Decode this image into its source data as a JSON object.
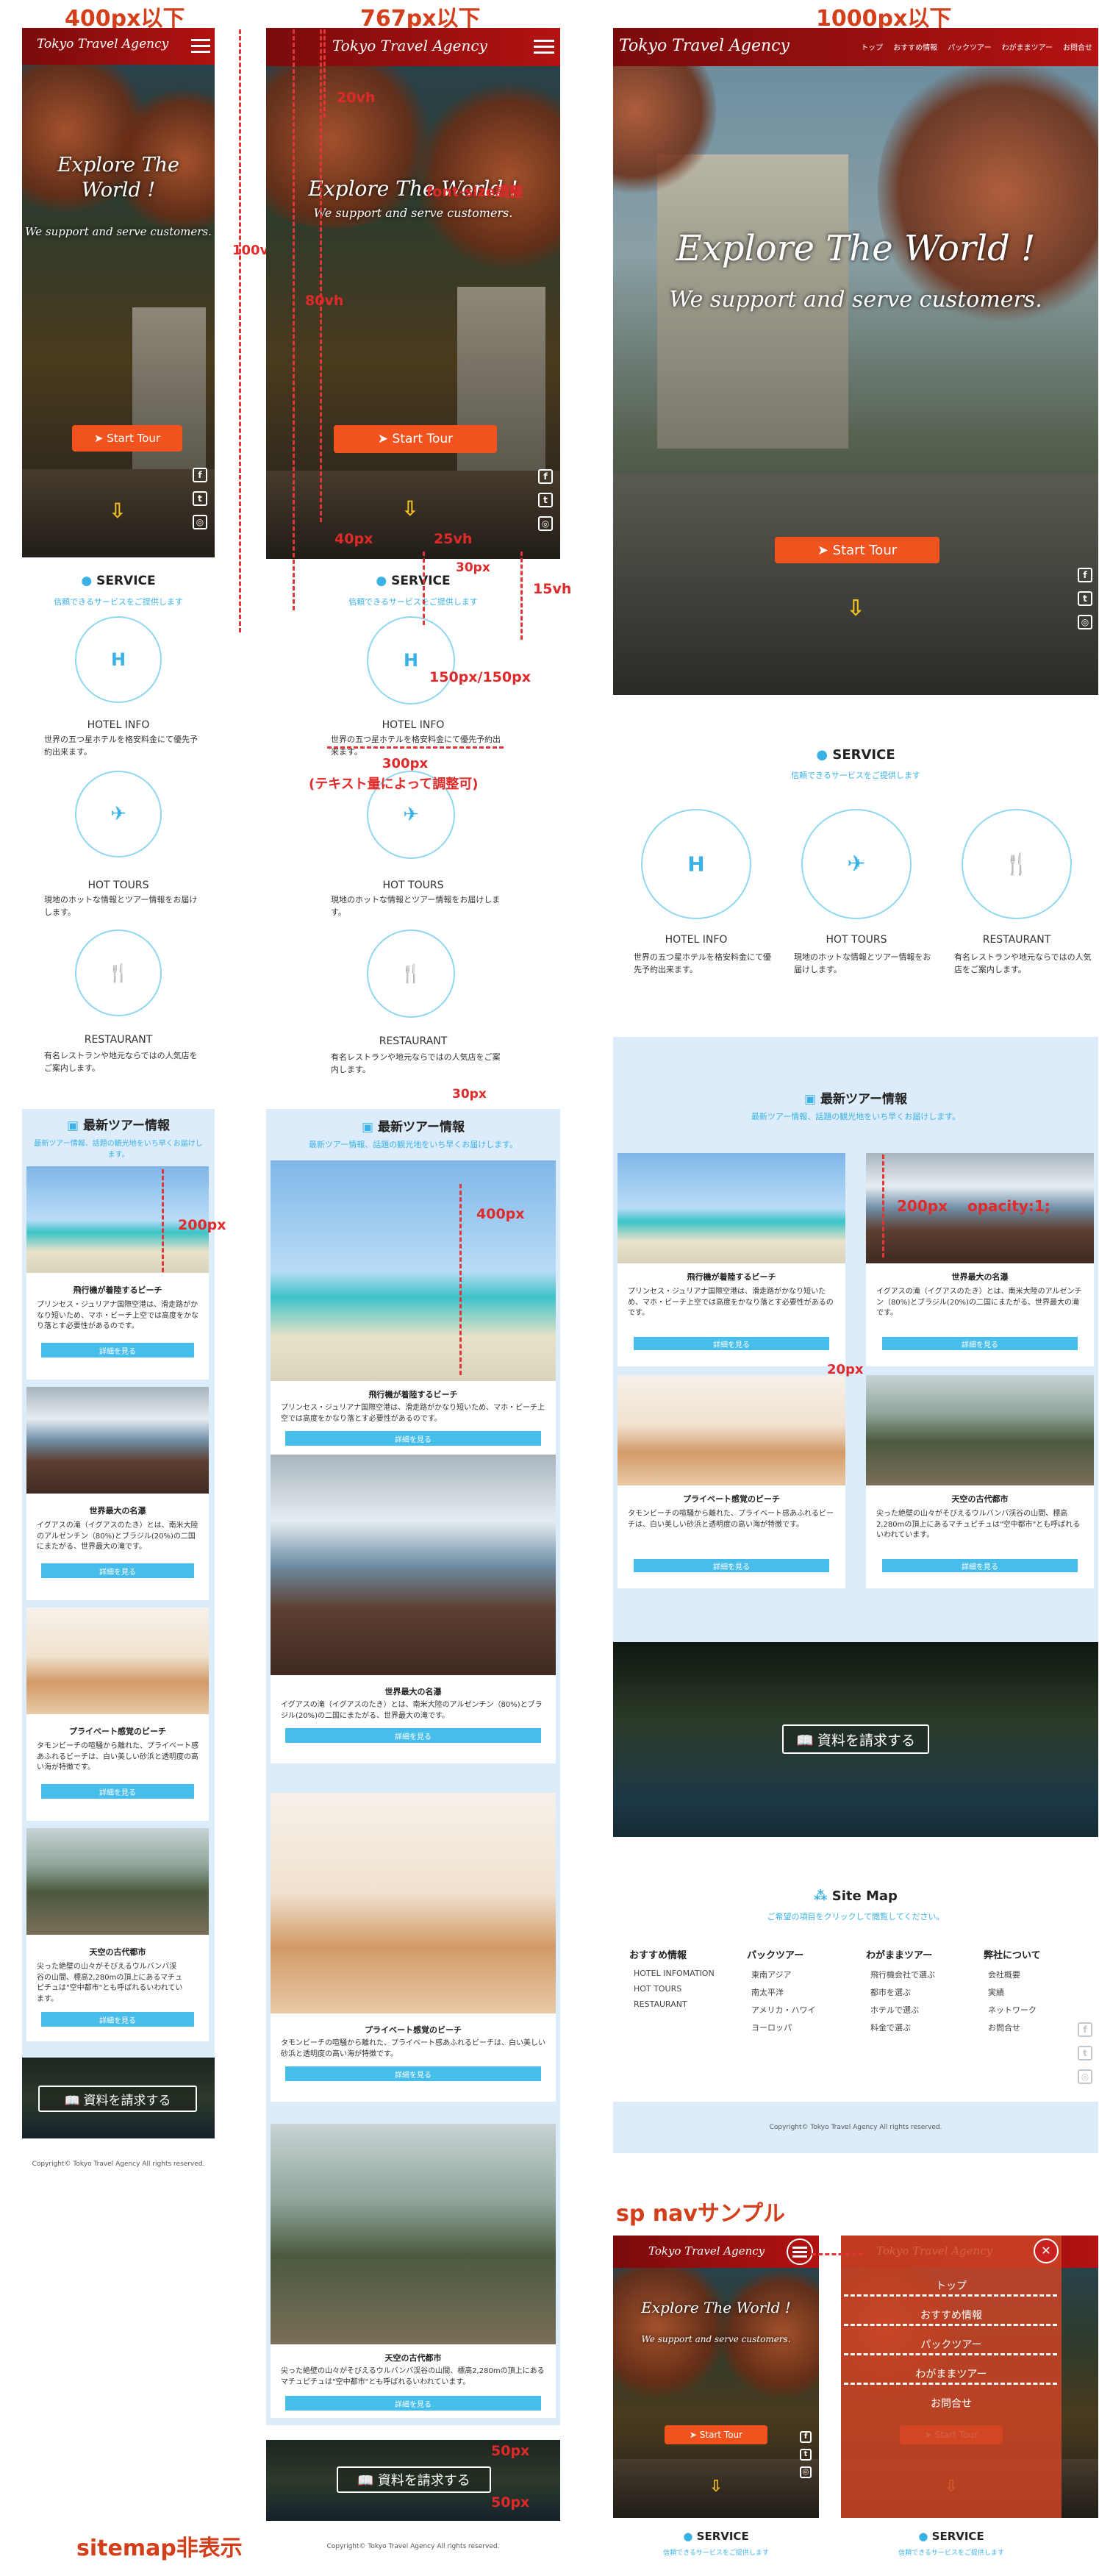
{
  "labels": {
    "h400": "400px以下",
    "h767": "767px以下",
    "h1000": "1000px以下",
    "sp_nav": "sp navサンプル",
    "sitemap_hidden": "sitemap非表示"
  },
  "annotations": {
    "vh100": "100vh",
    "vh80": "80vh",
    "vh20": "20vh",
    "fontsize": "font-size調整",
    "px40": "40px",
    "vh25": "25vh",
    "px30a": "30px",
    "vh15": "15vh",
    "circle_size": "150px/150px",
    "text_w": "300px",
    "text_w_note": "(テキスト量によって調整可)",
    "px30b": "30px",
    "px400": "400px",
    "px200a": "200px",
    "px200b": "200px",
    "opacity": "opacity:1;",
    "px20": "20px",
    "px50a": "50px",
    "px50b": "50px"
  },
  "brand": "Tokyo Travel Agency",
  "nav": [
    "トップ",
    "おすすめ情報",
    "パックツアー",
    "わがままツアー",
    "お問合せ"
  ],
  "hero": {
    "title": "Explore The World !",
    "subtitle": "We support and serve customers.",
    "button": "Start Tour",
    "scroll": "⇩"
  },
  "service": {
    "title": "SERVICE",
    "subtitle": "信頼できるサービスをご提供します",
    "items": [
      {
        "icon": "hotel-icon",
        "glyph": "H",
        "name": "HOTEL INFO",
        "desc": "世界の五つ星ホテルを格安料金にて優先予約出来ます。"
      },
      {
        "icon": "airplane-icon",
        "glyph": "✈",
        "name": "HOT TOURS",
        "desc": "現地のホットな情報とツアー情報をお届けします。"
      },
      {
        "icon": "restaurant-icon",
        "glyph": "🍴",
        "name": "RESTAURANT",
        "desc": "有名レストランや地元ならではの人気店をご案内します。"
      }
    ]
  },
  "tours": {
    "title": "最新ツアー情報",
    "subtitle": "最新ツアー情報、話題の観光地をいち早くお届けします。",
    "button": "詳細を見る",
    "items": [
      {
        "title": "飛行機が着陸するビーチ",
        "desc": "プリンセス・ジュリアナ国際空港は、滑走路がかなり短いため、マホ・ビーチ上空では高度をかなり落とす必要性があるのです。"
      },
      {
        "title": "世界最大の名瀑",
        "desc": "イグアスの滝（イグアスのたき）とは、南米大陸のアルゼンチン（80%)とブラジル(20%)の二国にまたがる、世界最大の滝です。"
      },
      {
        "title": "プライベート感覚のビーチ",
        "desc": "タモンビーチの喧騒から離れた、プライベート感あふれるビーチは、白い美しい砂浜と透明度の高い海が特徴です。"
      },
      {
        "title": "天空の古代都市",
        "desc": "尖った絶壁の山々がそびえるウルバンバ渓谷の山間、標高2,280mの頂上にあるマチュピチュは\"空中都市\"とも呼ばれるいわれています。"
      }
    ]
  },
  "request": {
    "label": "資料を請求する"
  },
  "sitemap": {
    "title": "Site Map",
    "subtitle": "ご希望の項目をクリックして閲覧してください。",
    "columns": [
      {
        "heading": "おすすめ情報",
        "items": [
          "HOTEL INFOMATION",
          "HOT TOURS",
          "RESTAURANT"
        ]
      },
      {
        "heading": "パックツアー",
        "items": [
          "東南アジア",
          "南太平洋",
          "アメリカ・ハワイ",
          "ヨーロッパ"
        ]
      },
      {
        "heading": "わがままツアー",
        "items": [
          "飛行機会社で選ぶ",
          "都市を選ぶ",
          "ホテルで選ぶ",
          "料金で選ぶ"
        ]
      },
      {
        "heading": "弊社について",
        "items": [
          "会社概要",
          "実績",
          "ネットワーク",
          "お問合せ"
        ]
      }
    ]
  },
  "copyright": "Copyright© Tokyo Travel Agency All rights reserved.",
  "spnav": {
    "items": [
      "トップ",
      "おすすめ情報",
      "パックツアー",
      "わがままツアー",
      "お問合せ"
    ],
    "close": "✕"
  },
  "colors": {
    "accent": "#f2531e",
    "header": "#9b1010",
    "tours_bg": "#dcecfb",
    "link": "#3bb2e6",
    "annotation": "#e02a2a"
  }
}
